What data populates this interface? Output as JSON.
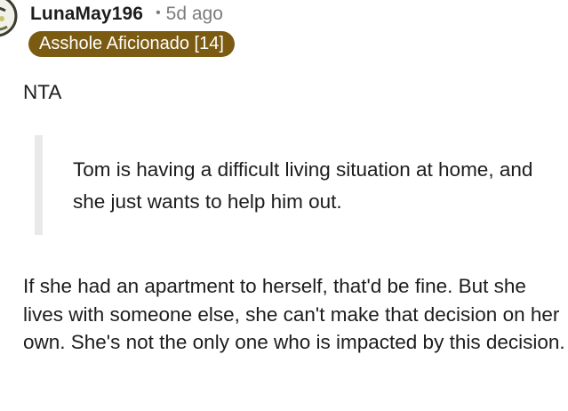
{
  "comment": {
    "author": "LunaMay196",
    "separator": "•",
    "age": "5d ago",
    "flair": "Asshole Aficionado [14]",
    "verdict": "NTA",
    "quote": "Tom is having a difficult living situation at home, and she just wants to help him out.",
    "body": "If she had an apartment to herself, that'd be fine. But she lives with someone else, she can't make that decision on her own. She's not the only one who is impacted by this decision."
  },
  "colors": {
    "flair_background": "#7b5b12",
    "flair_text": "#ffffff",
    "meta_text": "#7c7c7c",
    "quote_bar": "#e9e9e9"
  },
  "icons": {
    "avatar": "user-avatar-icon"
  }
}
